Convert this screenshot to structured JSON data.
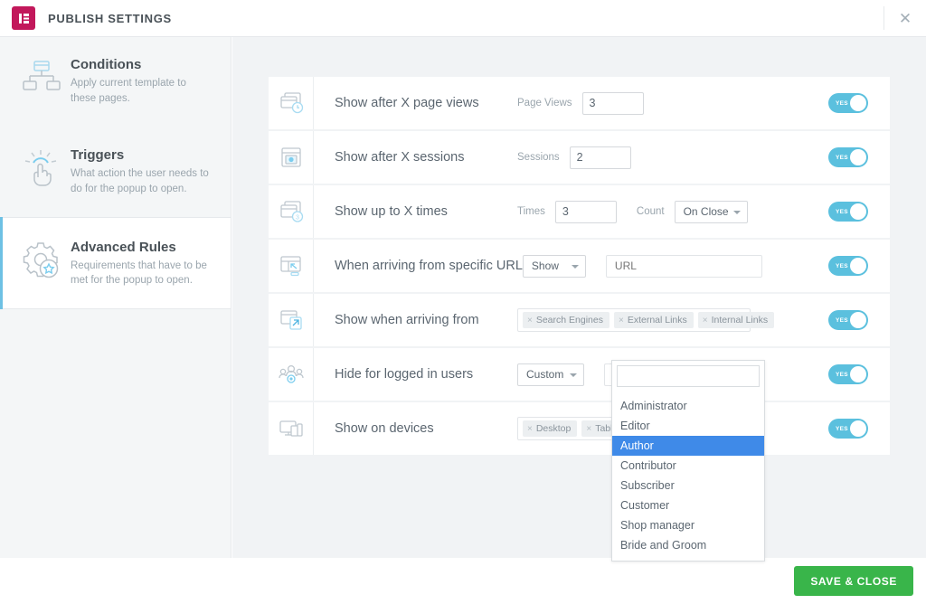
{
  "window": {
    "title": "PUBLISH SETTINGS",
    "logo_icon": "elementor-logo-icon",
    "close_icon": "close-icon",
    "accent_color": "#6ec1e4",
    "brand_color": "#c2185b",
    "save_color": "#39b54a"
  },
  "sidebar": {
    "items": [
      {
        "id": "conditions",
        "icon": "sitemap-icon",
        "title": "Conditions",
        "desc": "Apply current template to these pages.",
        "active": false
      },
      {
        "id": "triggers",
        "icon": "tap-hand-icon",
        "title": "Triggers",
        "desc": "What action the user needs to do for the popup to open.",
        "active": false
      },
      {
        "id": "advanced-rules",
        "icon": "gear-star-icon",
        "title": "Advanced Rules",
        "desc": "Requirements that have to be met for the popup to open.",
        "active": true
      }
    ]
  },
  "rules": [
    {
      "id": "page-views",
      "icon": "window-clock-icon",
      "label": "Show after X page views",
      "control_label": "Page Views",
      "number_value": "3",
      "toggle_label": "YES",
      "toggle_on": true
    },
    {
      "id": "sessions",
      "icon": "window-session-icon",
      "label": "Show after X sessions",
      "control_label": "Sessions",
      "number_value": "2",
      "toggle_label": "YES",
      "toggle_on": true
    },
    {
      "id": "show-up-to-x-times",
      "icon": "window-count-icon",
      "label": "Show up to X times",
      "control_label": "Times",
      "number_value": "3",
      "second_label": "Count",
      "select_value": "On Close",
      "toggle_label": "YES",
      "toggle_on": true
    },
    {
      "id": "specific-url",
      "icon": "window-arrow-icon",
      "label": "When arriving from specific URL",
      "select_value": "Show",
      "url_placeholder": "URL",
      "url_value": "",
      "toggle_label": "YES",
      "toggle_on": true
    },
    {
      "id": "arriving-from",
      "icon": "window-referrer-icon",
      "label": "Show when arriving from",
      "tags": [
        "Search Engines",
        "External Links",
        "Internal Links"
      ],
      "toggle_label": "YES",
      "toggle_on": true
    },
    {
      "id": "hide-logged-in",
      "icon": "users-icon",
      "label": "Hide for logged in users",
      "select_value": "Custom",
      "roles_value": "",
      "toggle_label": "YES",
      "toggle_on": true
    },
    {
      "id": "show-on-devices",
      "icon": "devices-icon",
      "label": "Show on devices",
      "tags": [
        "Desktop",
        "Tablet"
      ],
      "toggle_label": "YES",
      "toggle_on": true
    }
  ],
  "dropdown": {
    "search_value": "",
    "options": [
      "Administrator",
      "Editor",
      "Author",
      "Contributor",
      "Subscriber",
      "Customer",
      "Shop manager",
      "Bride and Groom"
    ],
    "selected": "Author"
  },
  "footer": {
    "save_label": "SAVE & CLOSE"
  }
}
